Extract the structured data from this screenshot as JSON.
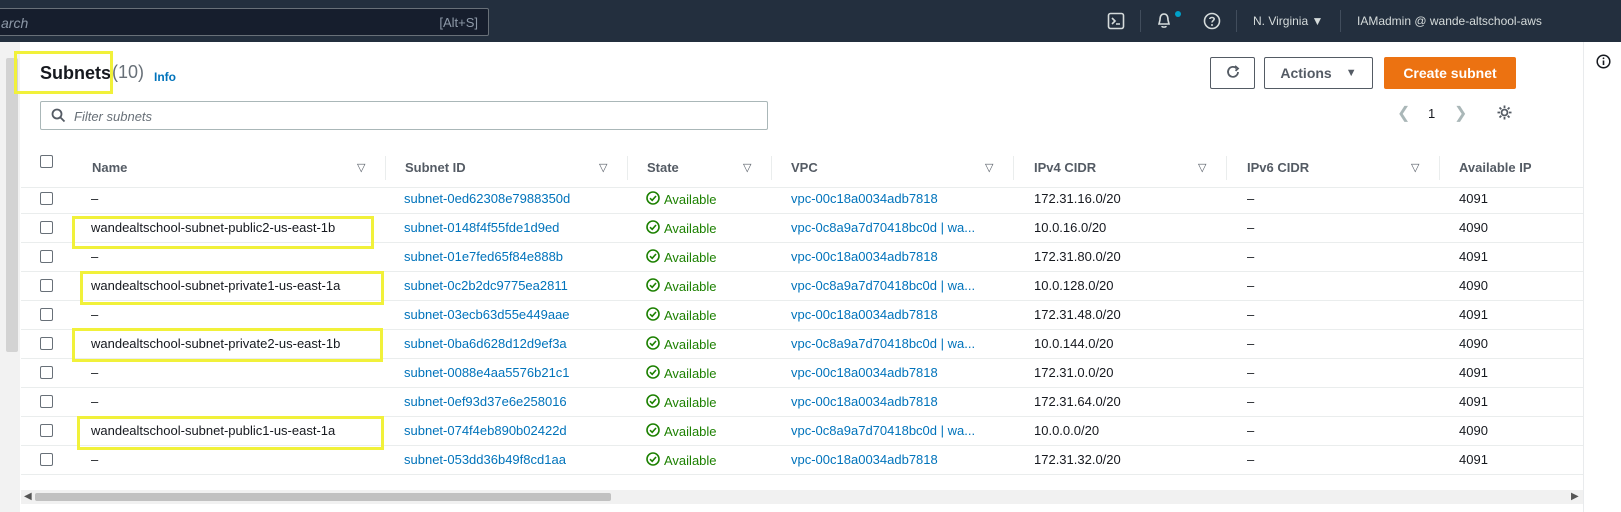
{
  "topbar": {
    "search_placeholder": "arch",
    "search_shortcut": "[Alt+S]",
    "region": "N. Virginia",
    "account": "IAMadmin @ wande-altschool-aws"
  },
  "header": {
    "title": "Subnets",
    "count": "(10)",
    "info": "Info",
    "actions_label": "Actions",
    "create_label": "Create subnet"
  },
  "filter": {
    "placeholder": "Filter subnets"
  },
  "pagination": {
    "page": "1"
  },
  "columns": [
    "Name",
    "Subnet ID",
    "State",
    "VPC",
    "IPv4 CIDR",
    "IPv6 CIDR",
    "Available IP"
  ],
  "rows": [
    {
      "name": "–",
      "subnet_id": "subnet-0ed62308e7988350d",
      "state": "Available",
      "vpc": "vpc-00c18a0034adb7818",
      "ipv4": "172.31.16.0/20",
      "ipv6": "–",
      "avail": "4091"
    },
    {
      "name": "wandealtschool-subnet-public2-us-east-1b",
      "subnet_id": "subnet-0148f4f55fde1d9ed",
      "state": "Available",
      "vpc": "vpc-0c8a9a7d70418bc0d | wa...",
      "ipv4": "10.0.16.0/20",
      "ipv6": "–",
      "avail": "4090"
    },
    {
      "name": "–",
      "subnet_id": "subnet-01e7fed65f84e888b",
      "state": "Available",
      "vpc": "vpc-00c18a0034adb7818",
      "ipv4": "172.31.80.0/20",
      "ipv6": "–",
      "avail": "4091"
    },
    {
      "name": "wandealtschool-subnet-private1-us-east-1a",
      "subnet_id": "subnet-0c2b2dc9775ea2811",
      "state": "Available",
      "vpc": "vpc-0c8a9a7d70418bc0d | wa...",
      "ipv4": "10.0.128.0/20",
      "ipv6": "–",
      "avail": "4090"
    },
    {
      "name": "–",
      "subnet_id": "subnet-03ecb63d55e449aae",
      "state": "Available",
      "vpc": "vpc-00c18a0034adb7818",
      "ipv4": "172.31.48.0/20",
      "ipv6": "–",
      "avail": "4091"
    },
    {
      "name": "wandealtschool-subnet-private2-us-east-1b",
      "subnet_id": "subnet-0ba6d628d12d9ef3a",
      "state": "Available",
      "vpc": "vpc-0c8a9a7d70418bc0d | wa...",
      "ipv4": "10.0.144.0/20",
      "ipv6": "–",
      "avail": "4090"
    },
    {
      "name": "–",
      "subnet_id": "subnet-0088e4aa5576b21c1",
      "state": "Available",
      "vpc": "vpc-00c18a0034adb7818",
      "ipv4": "172.31.0.0/20",
      "ipv6": "–",
      "avail": "4091"
    },
    {
      "name": "–",
      "subnet_id": "subnet-0ef93d37e6e258016",
      "state": "Available",
      "vpc": "vpc-00c18a0034adb7818",
      "ipv4": "172.31.64.0/20",
      "ipv6": "–",
      "avail": "4091"
    },
    {
      "name": "wandealtschool-subnet-public1-us-east-1a",
      "subnet_id": "subnet-074f4eb890b02422d",
      "state": "Available",
      "vpc": "vpc-0c8a9a7d70418bc0d | wa...",
      "ipv4": "10.0.0.0/20",
      "ipv6": "–",
      "avail": "4090"
    },
    {
      "name": "–",
      "subnet_id": "subnet-053dd36b49f8cd1aa",
      "state": "Available",
      "vpc": "vpc-00c18a0034adb7818",
      "ipv4": "172.31.32.0/20",
      "ipv6": "–",
      "avail": "4091"
    }
  ],
  "colors": {
    "accent": "#ec7211",
    "link": "#0073bb",
    "ok": "#1d8102",
    "highlight": "#f1f13a",
    "topbar": "#232f3e"
  }
}
